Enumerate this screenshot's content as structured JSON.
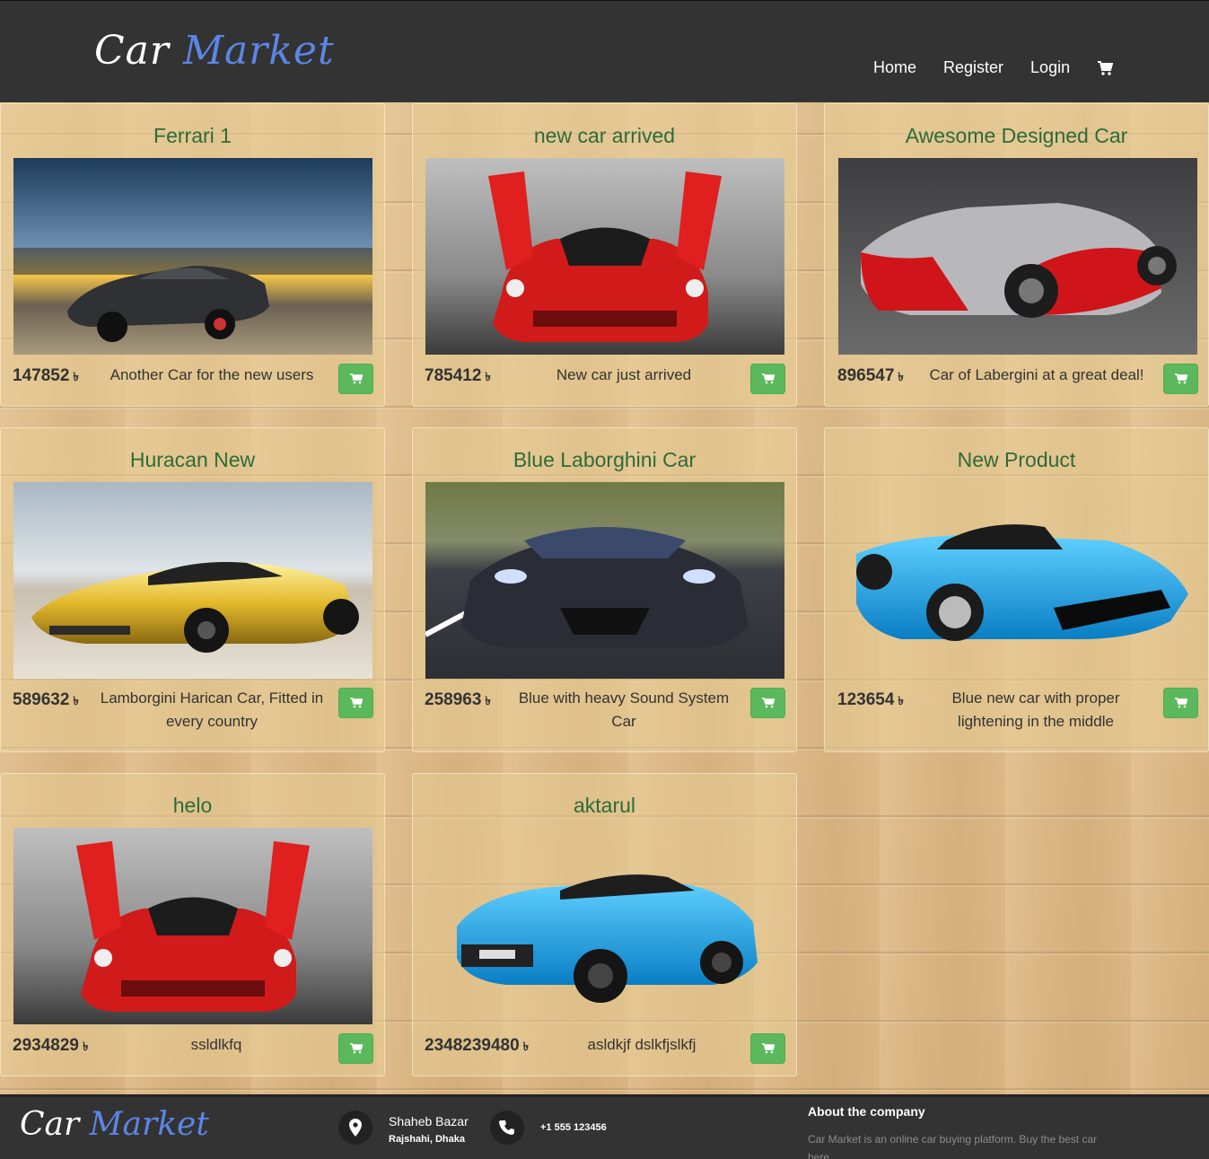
{
  "header": {
    "brand_part1": "Car",
    "brand_part2": "Market",
    "nav": {
      "home": "Home",
      "register": "Register",
      "login": "Login"
    },
    "cart_icon": "shopping-cart-icon"
  },
  "currency_symbol": "৳",
  "products": [
    {
      "title": "Ferrari 1",
      "price": "147852",
      "description": "Another Car for the new users"
    },
    {
      "title": "new car arrived",
      "price": "785412",
      "description": "New car just arrived"
    },
    {
      "title": "Awesome Designed Car",
      "price": "896547",
      "description": "Car of Labergini at a great deal!"
    },
    {
      "title": "Huracan New",
      "price": "589632",
      "description": "Lamborgini Harican Car, Fitted in every country"
    },
    {
      "title": "Blue Laborghini Car",
      "price": "258963",
      "description": "Blue with heavy Sound System Car"
    },
    {
      "title": "New Product",
      "price": "123654",
      "description": "Blue new car with proper lightening in the middle"
    },
    {
      "title": "helo",
      "price": "2934829",
      "description": "ssldlkfq"
    },
    {
      "title": "aktarul",
      "price": "2348239480",
      "description": "asldkjf dslkfjslkfj"
    }
  ],
  "footer": {
    "brand_part1": "Car",
    "brand_part2": "Market",
    "address_line1": "Shaheb Bazar",
    "address_line2": "Rajshahi, Dhaka",
    "phone": "+1 555 123456",
    "about_title": "About the company",
    "about_text": "Car Market is an online car buying platform. Buy the best car here."
  },
  "colors": {
    "navbar": "#333333",
    "brand_accent": "#5b86e5",
    "title_green": "#2e6b3a",
    "buy_button": "#5cb85c"
  }
}
